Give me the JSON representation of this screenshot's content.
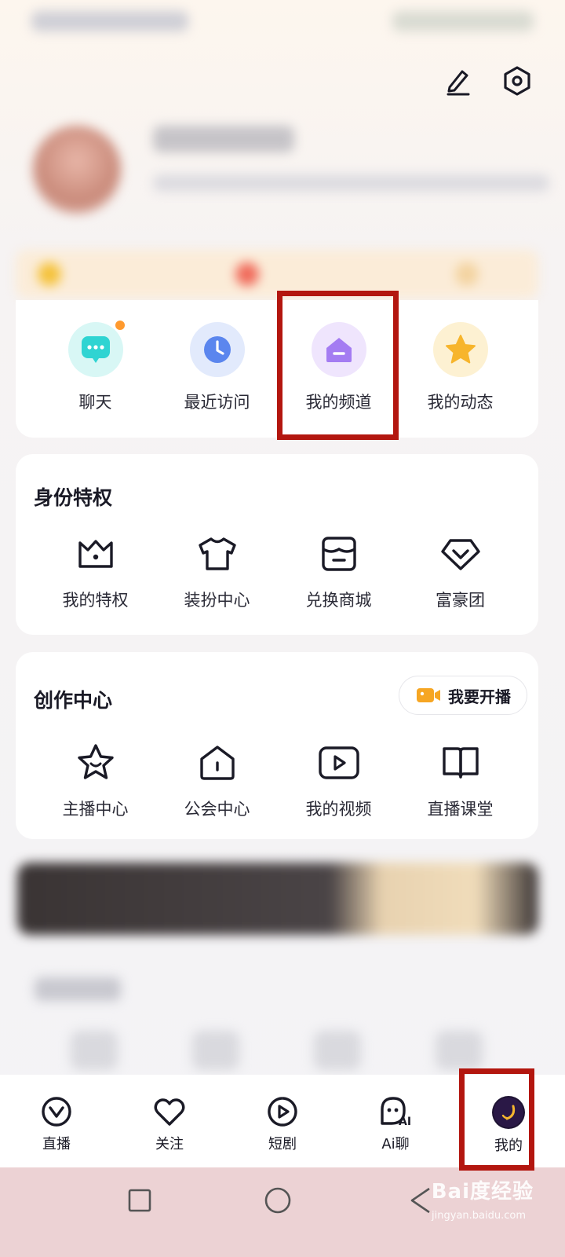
{
  "quick_actions": [
    {
      "label": "聊天",
      "icon": "chat-icon",
      "color": "#2fd4d2"
    },
    {
      "label": "最近访问",
      "icon": "clock-icon",
      "color": "#5b86ee"
    },
    {
      "label": "我的频道",
      "icon": "channel-icon",
      "color": "#a47cf2"
    },
    {
      "label": "我的动态",
      "icon": "star-icon",
      "color": "#f7b52c"
    }
  ],
  "privilege": {
    "title": "身份特权",
    "items": [
      {
        "label": "我的特权",
        "icon": "crown-icon"
      },
      {
        "label": "装扮中心",
        "icon": "tshirt-icon"
      },
      {
        "label": "兑换商城",
        "icon": "store-icon"
      },
      {
        "label": "富豪团",
        "icon": "diamond-icon"
      }
    ]
  },
  "creator": {
    "title": "创作中心",
    "broadcast_label": "我要开播",
    "items": [
      {
        "label": "主播中心",
        "icon": "star-face-icon"
      },
      {
        "label": "公会中心",
        "icon": "guild-house-icon"
      },
      {
        "label": "我的视频",
        "icon": "video-play-icon"
      },
      {
        "label": "直播课堂",
        "icon": "book-icon"
      }
    ]
  },
  "bottom_nav": [
    {
      "label": "直播",
      "icon": "live-icon"
    },
    {
      "label": "关注",
      "icon": "heart-icon"
    },
    {
      "label": "短剧",
      "icon": "play-icon"
    },
    {
      "label": "Ai聊",
      "icon": "ai-chat-icon"
    },
    {
      "label": "我的",
      "icon": "profile-avatar-icon",
      "active": true
    }
  ],
  "watermark": {
    "main": "Bai度经验",
    "sub": "jingyan.baidu.com"
  },
  "colors": {
    "highlight": "#b3160f",
    "accent": "#f6a623"
  }
}
